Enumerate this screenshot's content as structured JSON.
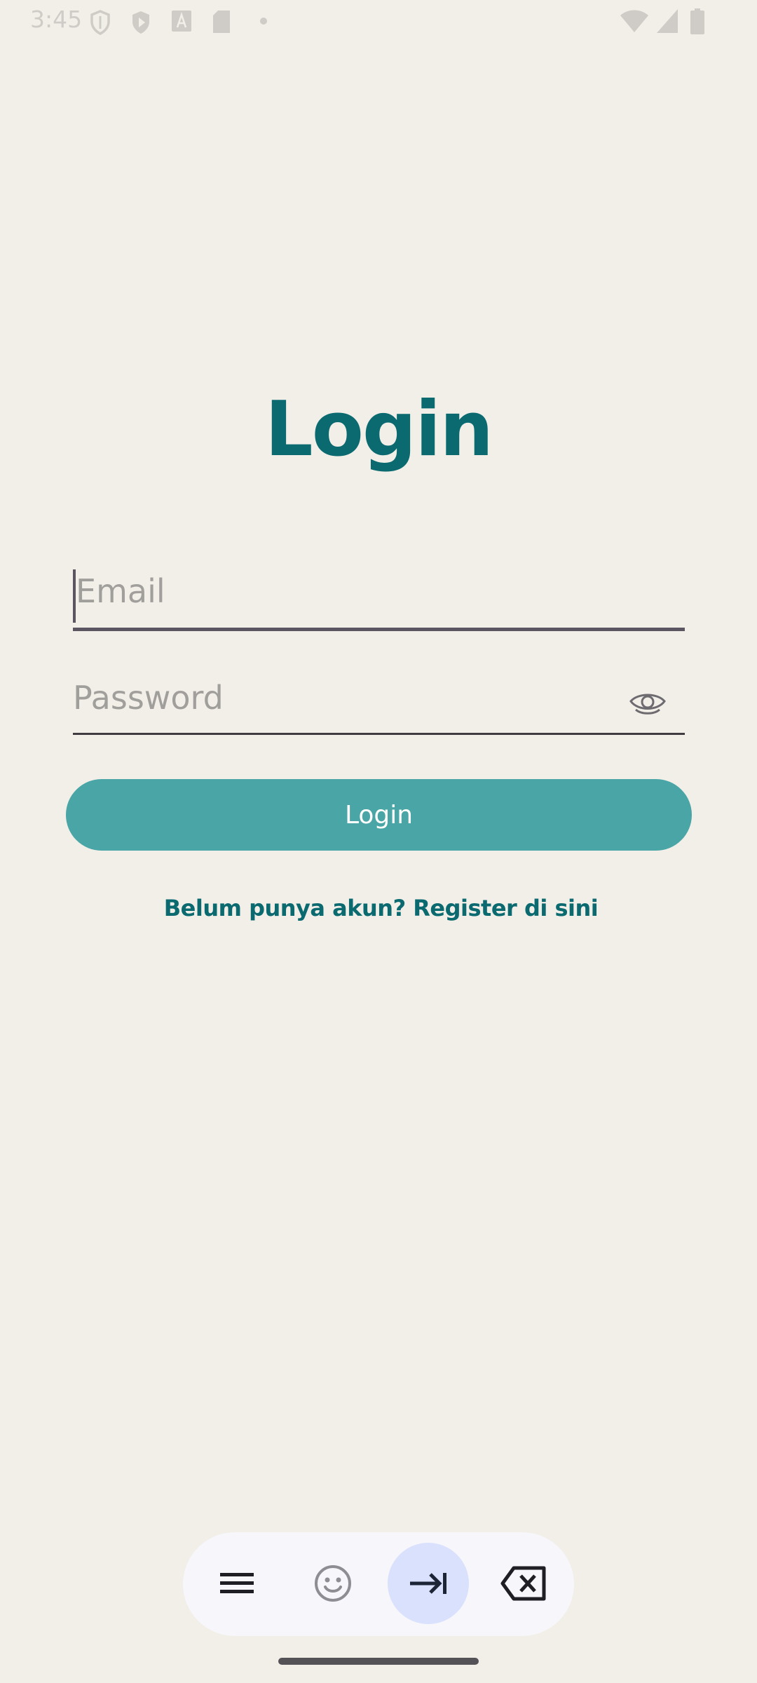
{
  "status_bar": {
    "time": "3:45",
    "icons": [
      "shield-icon",
      "play-protect-icon",
      "font-icon",
      "sd-card-icon",
      "dot-icon",
      "wifi-icon",
      "signal-icon",
      "battery-icon"
    ]
  },
  "login": {
    "title": "Login",
    "email_placeholder": "Email",
    "password_placeholder": "Password",
    "button_label": "Login",
    "register_link": "Belum punya akun? Register di sini"
  },
  "keyboard_toolbar": {
    "buttons": [
      "menu-icon",
      "emoji-icon",
      "tab-next-icon",
      "backspace-icon"
    ],
    "active": "tab-next-icon"
  },
  "colors": {
    "background": "#F2EFE9",
    "accent": "#0A6A70",
    "button": "#4AA6A6"
  }
}
